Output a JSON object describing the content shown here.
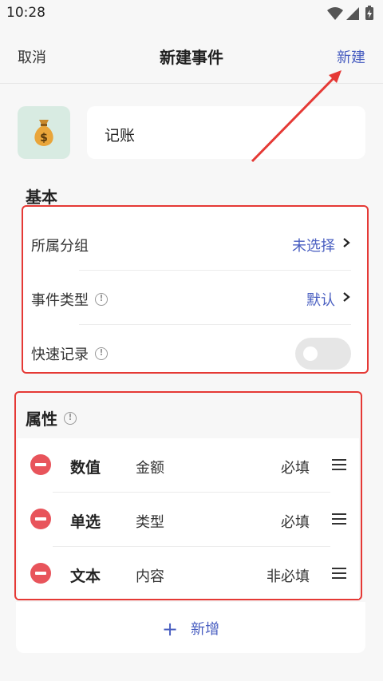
{
  "status": {
    "time": "10:28"
  },
  "nav": {
    "cancel": "取消",
    "title": "新建事件",
    "create": "新建"
  },
  "event": {
    "icon": "money-bag-icon",
    "name": "记账"
  },
  "basic": {
    "section_title": "基本",
    "rows": [
      {
        "label": "所属分组",
        "value": "未选择"
      },
      {
        "label": "事件类型",
        "value": "默认"
      },
      {
        "label": "快速记录",
        "toggle_on": false
      }
    ]
  },
  "properties": {
    "section_title": "属性",
    "items": [
      {
        "type": "数值",
        "name": "金额",
        "required": "必填"
      },
      {
        "type": "单选",
        "name": "类型",
        "required": "必填"
      },
      {
        "type": "文本",
        "name": "内容",
        "required": "非必填"
      }
    ],
    "add_label": "新增"
  },
  "colors": {
    "accent": "#4a5fc1",
    "highlight": "#e53935",
    "delete": "#e8545b"
  }
}
